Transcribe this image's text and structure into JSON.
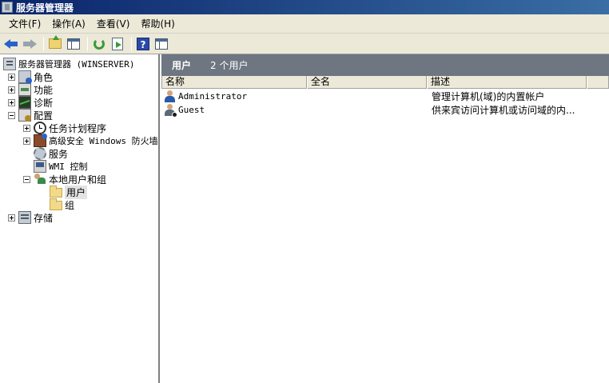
{
  "window": {
    "title": "服务器管理器"
  },
  "menu": {
    "items": [
      {
        "label": "文件(F)"
      },
      {
        "label": "操作(A)"
      },
      {
        "label": "查看(V)"
      },
      {
        "label": "帮助(H)"
      }
    ]
  },
  "toolbar": {
    "buttons": [
      {
        "icon": "back-arrow-icon"
      },
      {
        "icon": "forward-arrow-icon"
      },
      {
        "icon": "up-folder-icon"
      },
      {
        "icon": "show-hide-tree-icon"
      },
      {
        "icon": "refresh-icon"
      },
      {
        "icon": "export-list-icon"
      },
      {
        "icon": "help-icon"
      },
      {
        "icon": "show-action-pane-icon"
      }
    ]
  },
  "tree": {
    "root": "服务器管理器 (WINSERVER)",
    "roles": "角色",
    "features": "功能",
    "diagnostics": "诊断",
    "configuration": "配置",
    "task_scheduler": "任务计划程序",
    "firewall": "高级安全 Windows 防火墙",
    "services": "服务",
    "wmi_control": "WMI 控制",
    "local_users_groups": "本地用户和组",
    "users": "用户",
    "groups": "组",
    "storage": "存储"
  },
  "content": {
    "title": "用户",
    "count": "2 个用户",
    "columns": [
      "名称",
      "全名",
      "描述"
    ],
    "rows": [
      {
        "name": "Administrator",
        "full_name": "",
        "description": "管理计算机(域)的内置帐户"
      },
      {
        "name": "Guest",
        "full_name": "",
        "description": "供来宾访问计算机或访问域的内..."
      }
    ]
  }
}
